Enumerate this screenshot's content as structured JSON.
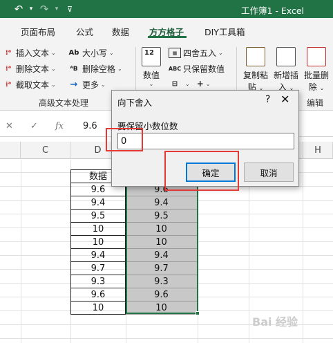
{
  "titlebar": {
    "title": "工作簿1  -  Excel",
    "icons": [
      "undo-icon",
      "redo-icon",
      "customize-qat-icon"
    ]
  },
  "tabs": [
    {
      "label": "页面布局"
    },
    {
      "label": "公式"
    },
    {
      "label": "数据"
    },
    {
      "label": "方方格子",
      "active": true
    },
    {
      "label": "DIY工具箱"
    }
  ],
  "ribbon": {
    "text_group": {
      "items": [
        "插入文本",
        "删除文本",
        "截取文本",
        "大小写",
        "删除空格",
        "更多"
      ],
      "label": "高级文本处理"
    },
    "number_group": {
      "big_button": "数值",
      "items": [
        "四舍五入",
        "只保留数值"
      ]
    },
    "edit_group": {
      "buttons": [
        {
          "line1": "复制粘",
          "line2": "贴"
        },
        {
          "line1": "新增插",
          "line2": "入"
        },
        {
          "line1": "批量删",
          "line2": "除"
        }
      ],
      "label": "编辑"
    }
  },
  "formula_bar": {
    "value": "9.6",
    "fx": "fx"
  },
  "columns": [
    "C",
    "D",
    "H"
  ],
  "table": {
    "header": "数据",
    "values_d": [
      "9.6",
      "9.4",
      "9.5",
      "10",
      "10",
      "9.4",
      "9.7",
      "9.3",
      "9.6",
      "10"
    ],
    "values_e": [
      "9.6",
      "9.4",
      "9.5",
      "10",
      "10",
      "9.4",
      "9.7",
      "9.3",
      "9.6",
      "10"
    ]
  },
  "dialog": {
    "title": "向下舍入",
    "help": "?",
    "label": "要保留小数位数",
    "input_value": "0",
    "ok": "确定",
    "cancel": "取消"
  },
  "watermark": "Bai 经验"
}
